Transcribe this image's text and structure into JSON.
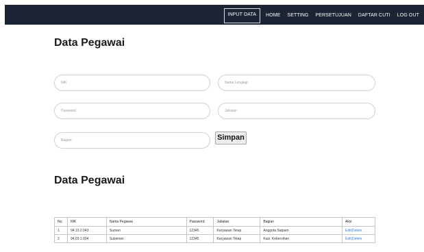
{
  "nav": {
    "items": [
      "INPUT DATA",
      "HOME",
      "SETTING",
      "PERSETUJUAN",
      "DAFTAR CUTI",
      "LOG OUT"
    ],
    "active": "INPUT DATA"
  },
  "form": {
    "title": "Data Pegawai",
    "nik_placeholder": "NIK",
    "nama_placeholder": "Nama Lengkap",
    "password_placeholder": "Password",
    "jabatan_placeholder": "Jabatan",
    "bagian_placeholder": "Bagian",
    "submit_label": "Simpan"
  },
  "table": {
    "title": "Data Pegawai",
    "headers": [
      "No",
      "NIK",
      "Nama Pegawai",
      "Password",
      "Jabatan",
      "Bagian",
      "Aksi"
    ],
    "rows": [
      [
        "1",
        "94.10.2.043",
        "Sumari",
        "12345",
        "Karyawan Tetap",
        "Anggota Satpam"
      ],
      [
        "2",
        "94.03.1.004",
        "Sulaiman",
        "12345",
        "Karyawan Tetap",
        "Kasi. Kebersihan"
      ]
    ],
    "edit_label": "Edit",
    "separator": "|",
    "delete_label": "Delete"
  },
  "colors": {
    "navbar": "#1c2533",
    "link": "#3d7bd9"
  }
}
